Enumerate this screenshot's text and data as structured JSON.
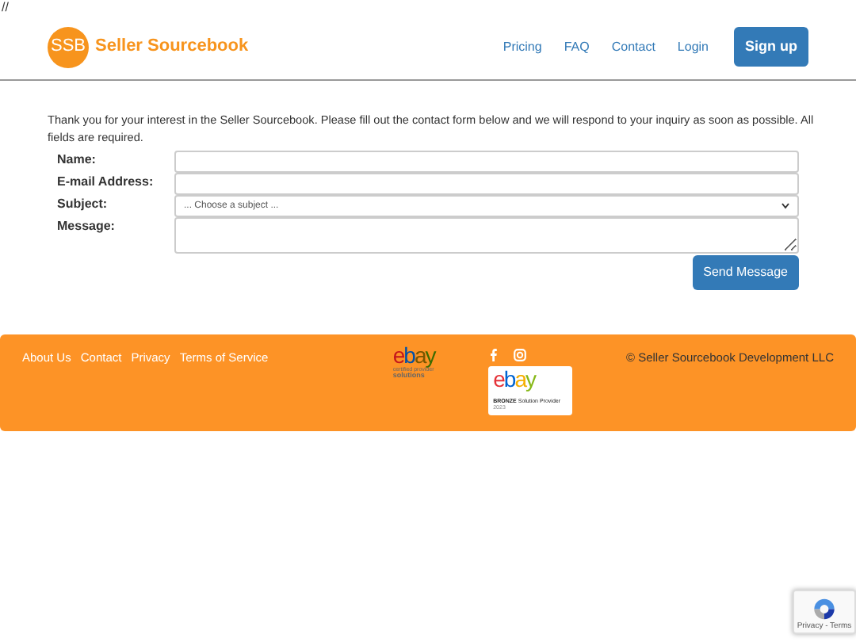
{
  "top_text": "//",
  "header": {
    "logo_mark": "SSB",
    "logo_text": "Seller Sourcebook",
    "nav": [
      "Pricing",
      "FAQ",
      "Contact",
      "Login"
    ],
    "signup": "Sign up"
  },
  "intro": "Thank you for your interest in the Seller Sourcebook. Please fill out the contact form below and we will respond to your inquiry as soon as possible. All fields are required.",
  "form": {
    "fields": [
      {
        "label": "Name:",
        "kind": "text"
      },
      {
        "label": "E-mail Address:",
        "kind": "text"
      },
      {
        "label": "Subject:",
        "kind": "select",
        "value": "... Choose a subject ..."
      },
      {
        "label": "Message:",
        "kind": "textarea"
      }
    ],
    "submit": "Send Message"
  },
  "footer": {
    "links": [
      "About Us",
      "Contact",
      "Privacy",
      "Terms of Service"
    ],
    "ebay_logo": {
      "letters": "ebay",
      "caption_1": "certified provider",
      "caption_2": "solutions"
    },
    "badge": {
      "letters": "ebay",
      "tier": "BRONZE",
      "line": "Solution Provider",
      "year": "2023"
    },
    "copyright": "© Seller Sourcebook Development LLC"
  },
  "recaptcha": {
    "text": "Privacy - Terms"
  }
}
